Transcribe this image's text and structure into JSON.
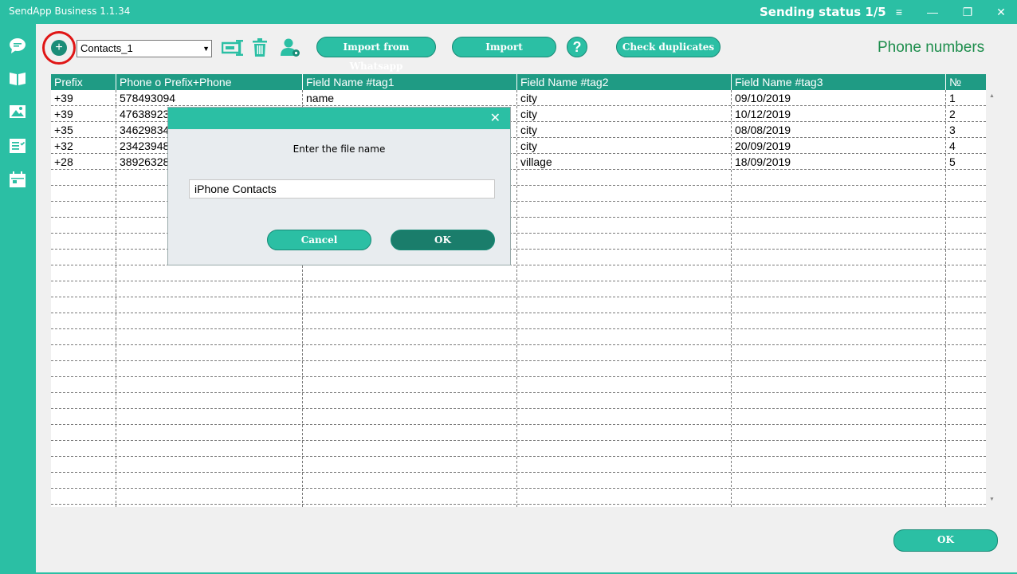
{
  "titlebar": {
    "app_title": "SendApp Business 1.1.34",
    "status": "Sending status 1/5"
  },
  "toolbar": {
    "combo_value": "Contacts_1",
    "import_whatsapp_label": "Import from Whatsapp",
    "import_label": "Import",
    "help_label": "?",
    "check_duplicates_label": "Check duplicates"
  },
  "page_title": "Phone numbers",
  "table": {
    "columns": [
      "Prefix",
      "Phone o Prefix+Phone",
      "Field Name #tag1",
      "Field Name #tag2",
      "Field Name #tag3",
      "№"
    ],
    "rows": [
      [
        "+39",
        "578493094",
        "name",
        "city",
        "09/10/2019",
        "1"
      ],
      [
        "+39",
        "47638923",
        "",
        "city",
        "10/12/2019",
        "2"
      ],
      [
        "+35",
        "34629834",
        "",
        "city",
        "08/08/2019",
        "3"
      ],
      [
        "+32",
        "23423948",
        "",
        "city",
        "20/09/2019",
        "4"
      ],
      [
        "+28",
        "38926328",
        "",
        "village",
        "18/09/2019",
        "5"
      ]
    ]
  },
  "dialog": {
    "prompt": "Enter the file name",
    "input_value": "iPhone Contacts",
    "cancel_label": "Cancel",
    "ok_label": "OK"
  },
  "footer": {
    "ok_label": "OK"
  },
  "colors": {
    "accent": "#2bbfa4",
    "header": "#1f9b84",
    "dark_button": "#1a7d6b",
    "title_green": "#1d8d4c",
    "highlight_ring": "#e01616"
  }
}
